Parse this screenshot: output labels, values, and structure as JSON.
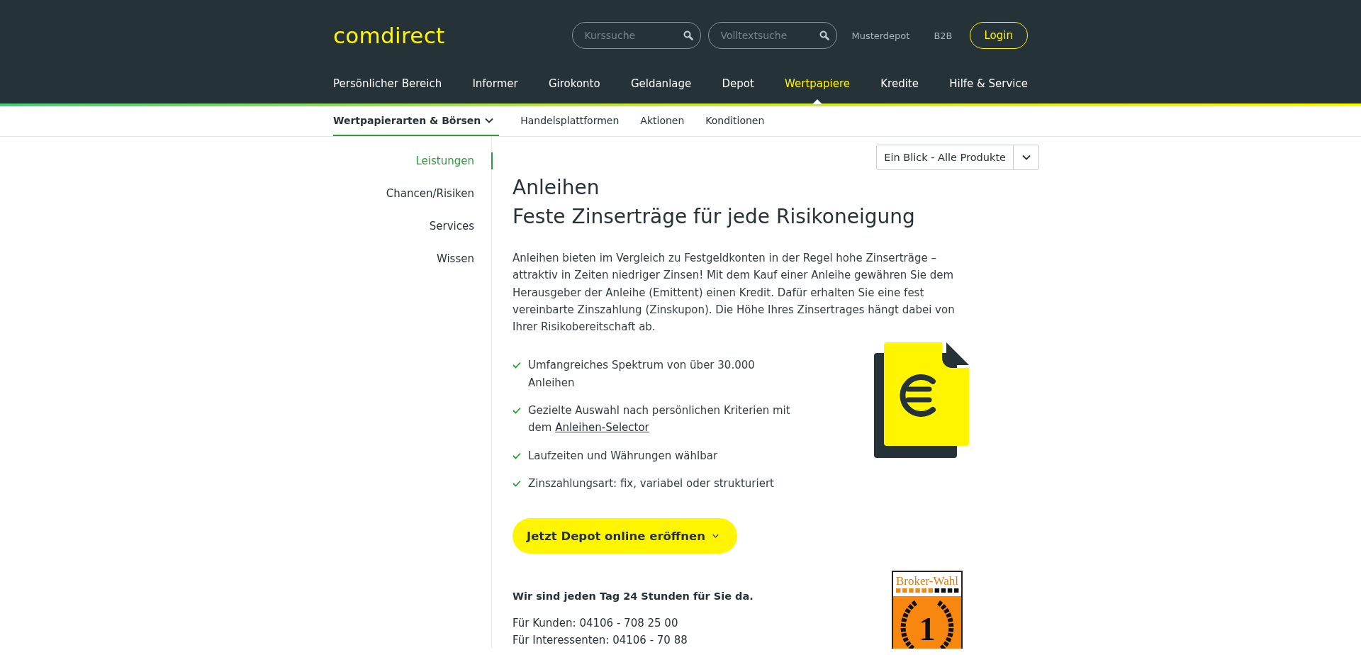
{
  "header": {
    "logo": "comdirect",
    "searches": [
      {
        "placeholder": "Kurssuche"
      },
      {
        "placeholder": "Volltextsuche"
      }
    ],
    "links": [
      "Musterdepot",
      "B2B"
    ],
    "login": "Login"
  },
  "main_nav": [
    {
      "label": "Persönlicher Bereich",
      "selected": false
    },
    {
      "label": "Informer",
      "selected": false
    },
    {
      "label": "Girokonto",
      "selected": false
    },
    {
      "label": "Geldanlage",
      "selected": false
    },
    {
      "label": "Depot",
      "selected": false
    },
    {
      "label": "Wertpapiere",
      "selected": true
    },
    {
      "label": "Kredite",
      "selected": false
    },
    {
      "label": "Hilfe & Service",
      "selected": false
    }
  ],
  "sub_nav": [
    {
      "label": "Wertpapierarten & Börsen",
      "selected": true,
      "dropdown": true
    },
    {
      "label": "Handelsplattformen",
      "selected": false,
      "dropdown": false
    },
    {
      "label": "Aktionen",
      "selected": false,
      "dropdown": false
    },
    {
      "label": "Konditionen",
      "selected": false,
      "dropdown": false
    }
  ],
  "sidebar": [
    {
      "label": "Leistungen",
      "selected": true
    },
    {
      "label": "Chancen/Risiken",
      "selected": false
    },
    {
      "label": "Services",
      "selected": false
    },
    {
      "label": "Wissen",
      "selected": false
    }
  ],
  "product_select": {
    "value": "Ein Blick - Alle Produkte"
  },
  "title": [
    "Anleihen",
    "Feste Zinserträge für jede Risikoneigung"
  ],
  "intro": "Anleihen bieten im Vergleich zu Festgeldkonten in der Regel hohe Zinserträge – attraktiv in Zeiten niedriger Zinsen! Mit dem Kauf einer Anleihe gewähren Sie dem Herausgeber der Anleihe (Emittent) einen Kredit. Dafür erhalten Sie eine fest vereinbarte Zinszahlung (Zinskupon). Die Höhe Ihres Zinsertrages hängt dabei von Ihrer Risikobereitschaft ab.",
  "features": [
    {
      "text": "Umfangreiches Spektrum von über 30.000 Anleihen"
    },
    {
      "text": "Gezielte Auswahl nach persönlichen Kriterien mit dem ",
      "link": "Anleihen-Selector"
    },
    {
      "text": "Laufzeiten und Währungen wählbar"
    },
    {
      "text": "Zinszahlungsart: fix, variabel oder strukturiert"
    }
  ],
  "cta": "Jetzt Depot online eröffnen",
  "contact": {
    "heading": "Wir sind jeden Tag 24 Stunden für Sie da.",
    "lines": [
      "Für Kunden: 04106 - 708 25 00",
      "Für Interessenten: 04106 - 70 88"
    ]
  },
  "badge": {
    "title": "Broker-Wahl",
    "rank": "1"
  }
}
